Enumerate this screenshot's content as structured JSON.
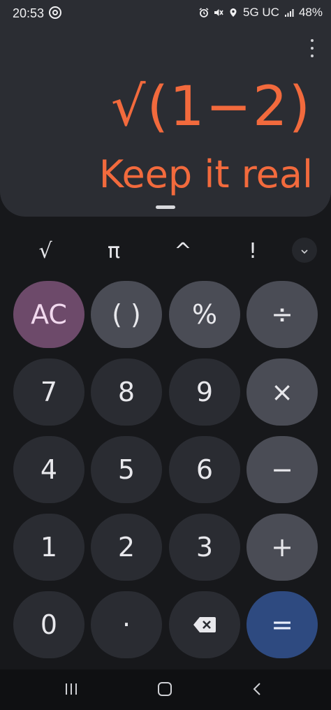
{
  "status_bar": {
    "time": "20:53",
    "network": "5G UC",
    "battery": "48%",
    "icons": [
      "nfc-icon",
      "alarm-icon",
      "mute-icon",
      "location-icon",
      "signal-icon"
    ]
  },
  "display": {
    "expression": "√(1−2)",
    "result": "Keep it real",
    "accent_color": "#f26a3d"
  },
  "scientific_row": {
    "keys": [
      "√",
      "π",
      "^",
      "!"
    ]
  },
  "keypad": {
    "ac": "AC",
    "paren": "( )",
    "percent": "%",
    "divide": "÷",
    "seven": "7",
    "eight": "8",
    "nine": "9",
    "multiply": "×",
    "four": "4",
    "five": "5",
    "six": "6",
    "minus": "−",
    "one": "1",
    "two": "2",
    "three": "3",
    "plus": "+",
    "zero": "0",
    "decimal": "·",
    "equals": "="
  },
  "colors": {
    "ac_key": "#6d4a6a",
    "operator_key": "#4a4c55",
    "digit_key": "#2a2c32",
    "equals_key": "#2e4a80"
  }
}
